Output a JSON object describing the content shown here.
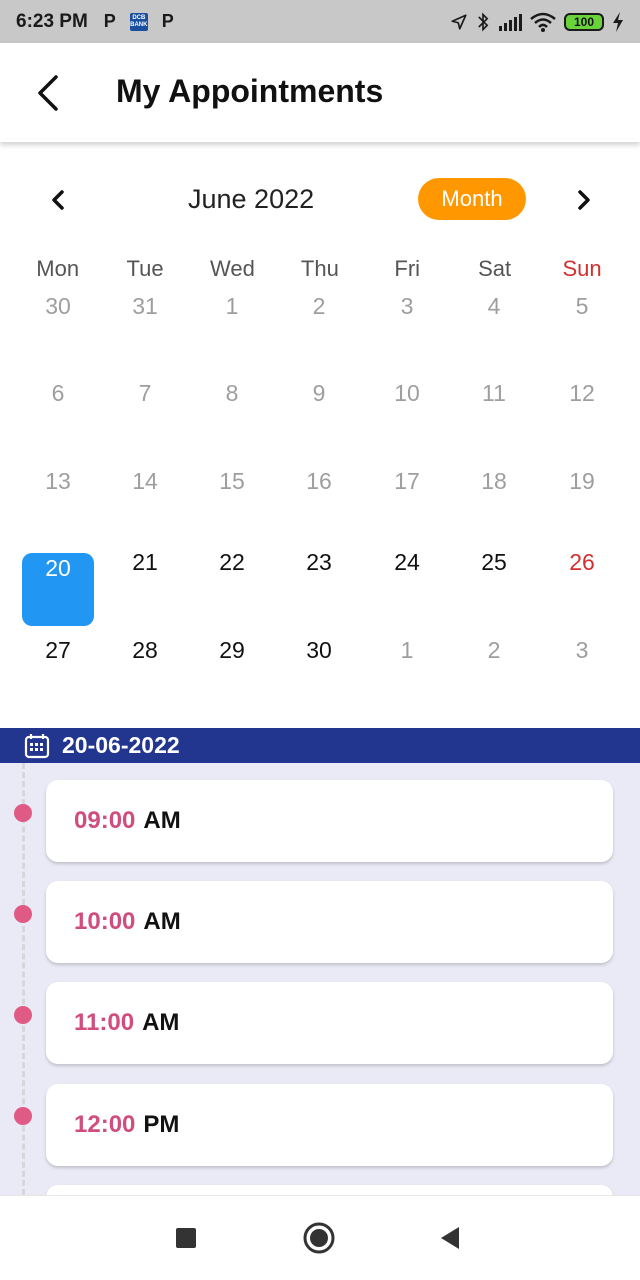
{
  "status_bar": {
    "time": "6:23 PM",
    "app_icons": [
      "P",
      "DCB",
      "P"
    ],
    "dcb_text": [
      "DCB",
      "BANK"
    ],
    "battery": "100"
  },
  "app_bar": {
    "title": "My Appointments",
    "back_icon": "chevron-left-icon"
  },
  "calendar": {
    "month_label": "June 2022",
    "view_button": "Month",
    "weekdays": [
      "Mon",
      "Tue",
      "Wed",
      "Thu",
      "Fri",
      "Sat",
      "Sun"
    ],
    "weeks": [
      [
        "30",
        "31",
        "1",
        "2",
        "3",
        "4",
        "5"
      ],
      [
        "6",
        "7",
        "8",
        "9",
        "10",
        "11",
        "12"
      ],
      [
        "13",
        "14",
        "15",
        "16",
        "17",
        "18",
        "19"
      ],
      [
        "20",
        "21",
        "22",
        "23",
        "24",
        "25",
        "26"
      ],
      [
        "27",
        "28",
        "29",
        "30",
        "1",
        "2",
        "3"
      ]
    ],
    "selected_day": "20"
  },
  "selected_date_banner": {
    "icon": "calendar-icon",
    "date": "20-06-2022"
  },
  "time_slots": [
    {
      "time": "09:00",
      "period": "AM"
    },
    {
      "time": "10:00",
      "period": "AM"
    },
    {
      "time": "11:00",
      "period": "AM"
    },
    {
      "time": "12:00",
      "period": "PM"
    }
  ],
  "nav_bar": {
    "buttons": [
      "recent-apps-icon",
      "home-icon",
      "back-icon"
    ]
  },
  "colors": {
    "accent_orange": "#ff9800",
    "selected_blue": "#2196f3",
    "banner_navy": "#22358f",
    "slot_pink": "#d14d7e",
    "sunday_red": "#d32f2f"
  }
}
